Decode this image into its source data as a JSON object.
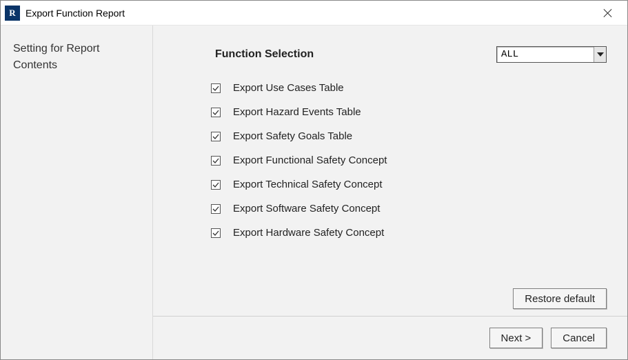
{
  "titlebar": {
    "icon_letter": "R",
    "title": "Export Function Report"
  },
  "sidebar": {
    "heading": "Setting for Report Contents"
  },
  "main": {
    "selection_label": "Function Selection",
    "combo_value": "ALL",
    "checks": [
      {
        "label": "Export Use Cases Table"
      },
      {
        "label": "Export Hazard Events Table"
      },
      {
        "label": "Export Safety Goals Table"
      },
      {
        "label": "Export Functional Safety Concept"
      },
      {
        "label": "Export Technical Safety Concept"
      },
      {
        "label": "Export Software Safety Concept"
      },
      {
        "label": "Export Hardware Safety Concept"
      }
    ],
    "restore_label": "Restore default"
  },
  "footer": {
    "next_label": "Next >",
    "cancel_label": "Cancel"
  }
}
